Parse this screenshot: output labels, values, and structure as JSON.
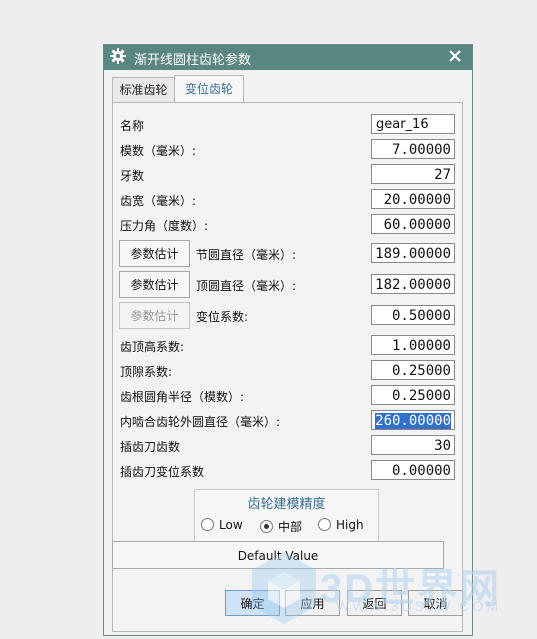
{
  "dialog": {
    "title": "渐开线圆柱齿轮参数",
    "icons": {
      "title": "gear-icon",
      "close": "close-icon"
    },
    "tabs": [
      {
        "label": "标准齿轮",
        "active": false
      },
      {
        "label": "变位齿轮",
        "active": true
      }
    ]
  },
  "form": {
    "name": {
      "label": "名称",
      "value": "gear_16"
    },
    "module": {
      "label": "模数（毫米）:",
      "value": "7.00000"
    },
    "teeth": {
      "label": "牙数",
      "value": "27"
    },
    "face_width": {
      "label": "齿宽（毫米）:",
      "value": "20.00000"
    },
    "pressure_angle": {
      "label": "压力角（度数）:",
      "value": "60.00000"
    },
    "pitch_diameter": {
      "label": "节圆直径（毫米）:",
      "value": "189.00000",
      "button": "参数估计"
    },
    "tip_diameter": {
      "label": "顶圆直径（毫米）:",
      "value": "182.00000",
      "button": "参数估计"
    },
    "shift_coeff": {
      "label": "变位系数:",
      "value": "0.50000",
      "button": "参数估计"
    },
    "addendum_coeff": {
      "label": "齿顶高系数:",
      "value": "1.00000"
    },
    "clearance_coeff": {
      "label": "顶隙系数:",
      "value": "0.25000"
    },
    "root_fillet": {
      "label": "齿根圆角半径（模数）:",
      "value": "0.25000"
    },
    "internal_diameter": {
      "label": "内啮合齿轮外圆直径（毫米）:",
      "value": "260.00000"
    },
    "cutter_teeth": {
      "label": "插齿刀齿数",
      "value": "30"
    },
    "cutter_shift": {
      "label": "插齿刀变位系数",
      "value": "0.00000"
    }
  },
  "precision": {
    "title": "齿轮建模精度",
    "options": [
      {
        "label": "Low",
        "selected": false
      },
      {
        "label": "中部",
        "selected": true
      },
      {
        "label": "High",
        "selected": false
      }
    ]
  },
  "buttons": {
    "default": "Default Value",
    "ok": "确定",
    "apply": "应用",
    "back": "返回",
    "cancel": "取消"
  },
  "watermark": {
    "text": "3D世界网",
    "url": "WWW.3DSJW.COM"
  },
  "colors": {
    "titlebar": "#5a8682",
    "accent": "#3a6e9b",
    "selection": "#2f6fd1"
  }
}
